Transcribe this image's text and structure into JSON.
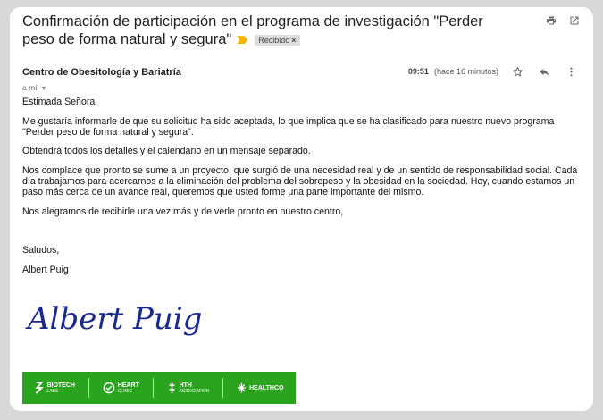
{
  "email": {
    "subject": "Confirmación de participación en el programa de investigación \"Perder peso de forma natural y segura\"",
    "label": "Recibido",
    "sender": "Centro de Obesitología y Bariatría",
    "to": "a mí",
    "time": "09:51",
    "time_relative": "(hace 16 minutos)"
  },
  "icons": {
    "print": "print-icon",
    "popout": "open-in-new-window-icon",
    "star": "star-icon",
    "reply": "reply-icon",
    "more": "more-vertical-icon",
    "important": "important-marker-icon"
  },
  "body": {
    "greeting": "Estimada Señora",
    "p1": "Me gustaría informarle de que su solicitud ha sido aceptada, lo que implica que se ha clasificado para nuestro nuevo programa \"Perder peso de forma natural y segura\".",
    "p2": "Obtendrá todos los detalles y el calendario en un mensaje separado.",
    "p3": "Nos complace que pronto se sume a un proyecto, que surgió de una necesidad real y de un sentido de responsabilidad social. Cada día trabajamos para acercarnos a la eliminación del problema del sobrepeso y la obesidad en la sociedad. Hoy, cuando estamos un paso más cerca de un avance real, queremos que usted forme una parte importante del mismo.",
    "p4": "Nos alegramos de recibirle una vez más y de verle pronto en nuestro centro,",
    "closing": "Saludos,",
    "signer": "Albert Puig",
    "signature_text": "Albert Puig"
  },
  "logos": [
    {
      "line1": "BIOTECH",
      "line2": "LABS"
    },
    {
      "line1": "HEART",
      "line2": "CLINIC"
    },
    {
      "line1": "HTH",
      "line2": "ASSOCIATION"
    },
    {
      "line1": "HEALTHCO",
      "line2": ""
    }
  ],
  "colors": {
    "logo_bar": "#2aa31f",
    "important": "#f4b400",
    "signature_ink": "#1a2a8c"
  }
}
